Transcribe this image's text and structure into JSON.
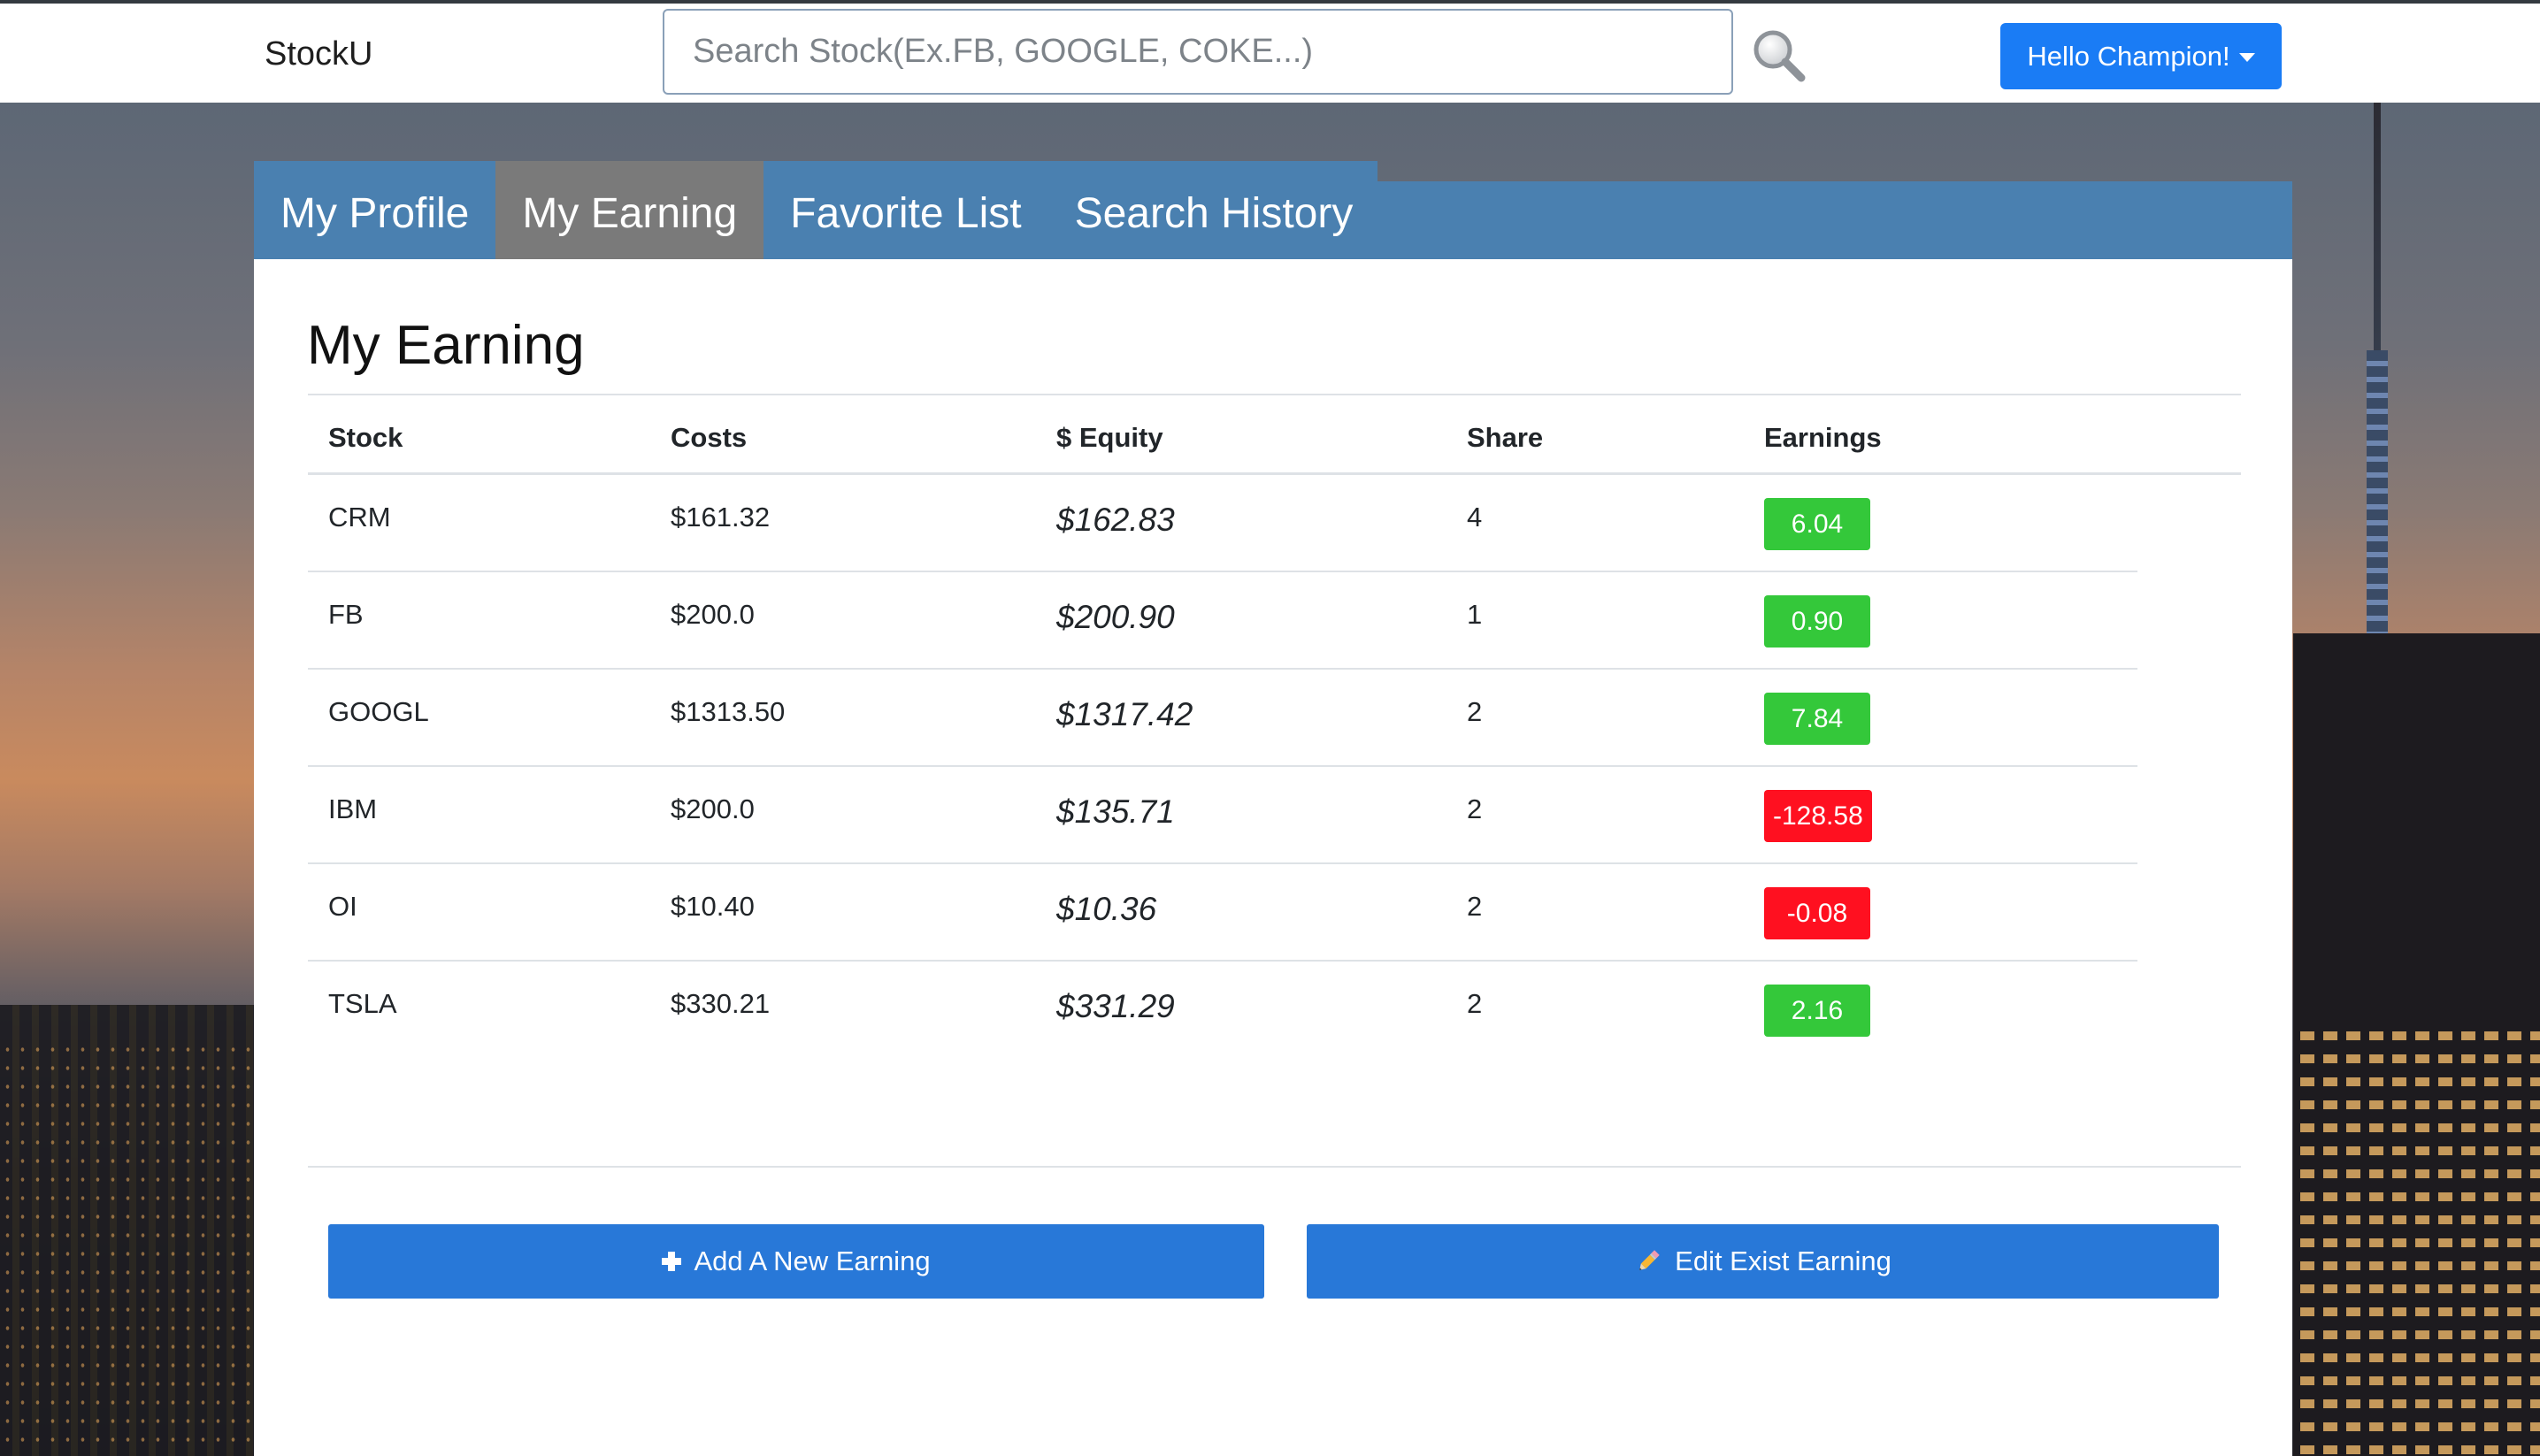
{
  "app": {
    "brand": "StockU",
    "search_placeholder": "Search Stock(Ex.FB, GOOGLE, COKE...)",
    "user_menu_label": "Hello Champion!"
  },
  "tabs": [
    {
      "label": "My Profile",
      "active": false
    },
    {
      "label": "My Earning",
      "active": true
    },
    {
      "label": "Favorite List",
      "active": false
    },
    {
      "label": "Search History",
      "active": false
    }
  ],
  "earning": {
    "title": "My Earning",
    "columns": [
      "Stock",
      "Costs",
      "$ Equity",
      "Share",
      "Earnings"
    ],
    "rows": [
      {
        "stock": "CRM",
        "costs": "$161.32",
        "equity": "$162.83",
        "share": "4",
        "earnings": "6.04",
        "status": "positive"
      },
      {
        "stock": "FB",
        "costs": "$200.0",
        "equity": "$200.90",
        "share": "1",
        "earnings": "0.90",
        "status": "positive"
      },
      {
        "stock": "GOOGL",
        "costs": "$1313.50",
        "equity": "$1317.42",
        "share": "2",
        "earnings": "7.84",
        "status": "positive"
      },
      {
        "stock": "IBM",
        "costs": "$200.0",
        "equity": "$135.71",
        "share": "2",
        "earnings": "-128.58",
        "status": "negative"
      },
      {
        "stock": "OI",
        "costs": "$10.40",
        "equity": "$10.36",
        "share": "2",
        "earnings": "-0.08",
        "status": "negative"
      },
      {
        "stock": "TSLA",
        "costs": "$330.21",
        "equity": "$331.29",
        "share": "2",
        "earnings": "2.16",
        "status": "positive"
      }
    ],
    "add_button_label": "Add A New Earning",
    "edit_button_label": "Edit Exist Earning"
  },
  "colors": {
    "positive": "#34c83a",
    "negative": "#ff1020",
    "tab_bar": "#4a80b0",
    "tab_active": "#7a7a7a",
    "primary": "#1a7cf5"
  },
  "icons": {
    "search": "magnifier-icon",
    "add": "plus-icon",
    "edit": "pencil-icon"
  }
}
